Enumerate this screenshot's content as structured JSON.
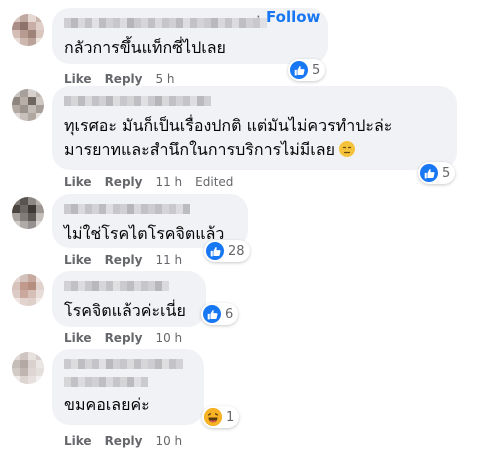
{
  "comments": [
    {
      "text_lines": [
        "กลัวการขึ้นแท็กซี่ไปเลย"
      ],
      "follow_label": "Follow",
      "follow_sep": "·",
      "like_label": "Like",
      "reply_label": "Reply",
      "time": "5 h",
      "reaction_count": "5",
      "reaction_icon": "like-icon"
    },
    {
      "text_lines": [
        "ทุเรศอะ มันก็เป็นเรื่องปกติ แต่มันไม่ควรทำปะล่ะ",
        "มารยาทและสำนึกในการบริการไม่มีเลย"
      ],
      "trailing_emoji": "unamused-emoji",
      "like_label": "Like",
      "reply_label": "Reply",
      "time": "11 h",
      "edited_label": "Edited",
      "reaction_count": "5",
      "reaction_icon": "like-icon"
    },
    {
      "text_lines": [
        "ไม่ใช่โรคไตโรคจิตแล้ว"
      ],
      "like_label": "Like",
      "reply_label": "Reply",
      "time": "11 h",
      "reaction_count": "28",
      "reaction_icon": "like-icon"
    },
    {
      "text_lines": [
        "โรคจิตแล้วค่ะเนี่ย"
      ],
      "like_label": "Like",
      "reply_label": "Reply",
      "time": "10 h",
      "reaction_count": "6",
      "reaction_icon": "like-icon"
    },
    {
      "text_lines": [
        "ขมคอเลยค่ะ"
      ],
      "like_label": "Like",
      "reply_label": "Reply",
      "time": "10 h",
      "reaction_count": "1",
      "reaction_icon": "haha-icon"
    }
  ],
  "colors": {
    "link_blue": "#1877f2",
    "bubble_bg": "#f0f2f5",
    "meta_gray": "#65676b",
    "like_blue": "#1877f2",
    "haha_yellow": "#f7b125"
  }
}
